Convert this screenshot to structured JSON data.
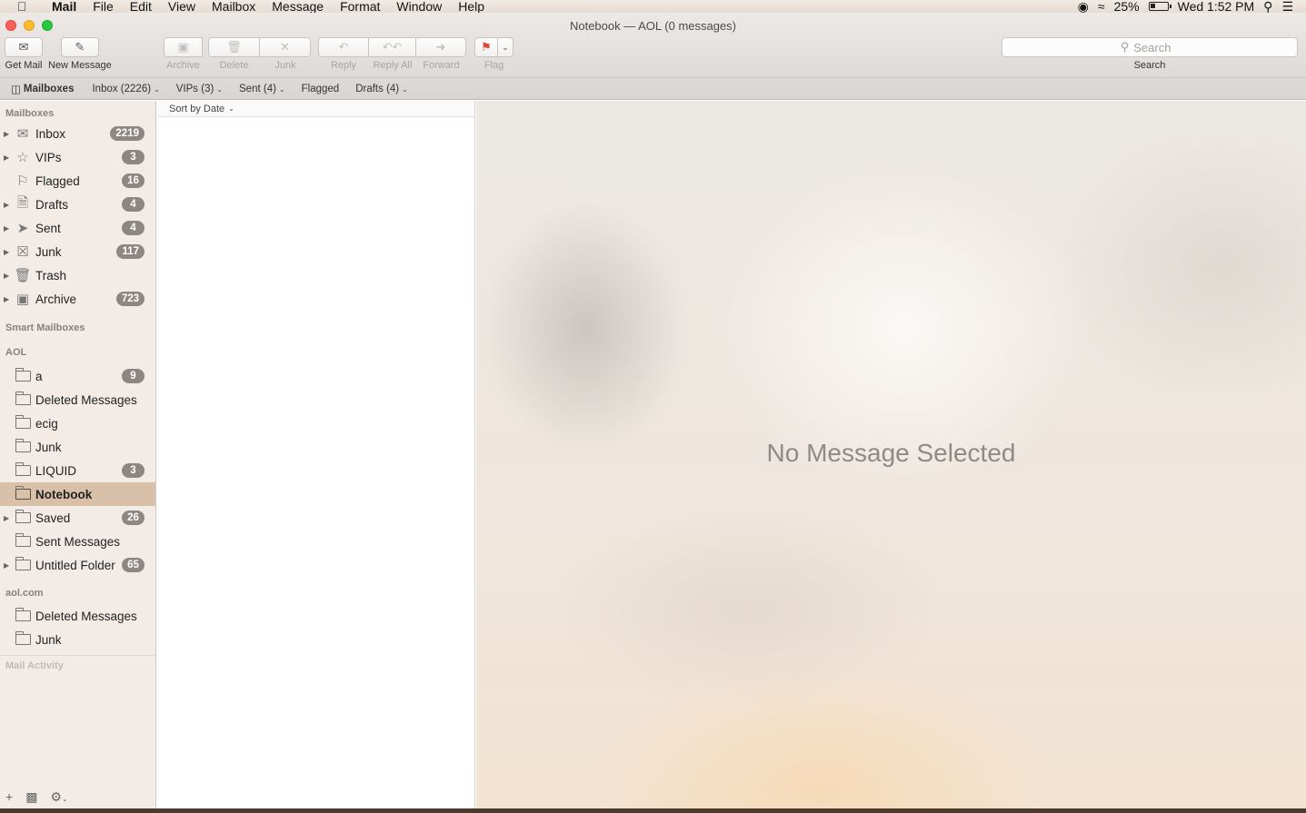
{
  "menubar": {
    "app": "Mail",
    "items": [
      "File",
      "Edit",
      "View",
      "Mailbox",
      "Message",
      "Format",
      "Window",
      "Help"
    ],
    "battery": "25%",
    "clock": "Wed 1:52 PM"
  },
  "window": {
    "title": "Notebook — AOL (0 messages)"
  },
  "toolbar": {
    "get_mail": "Get Mail",
    "new_message": "New Message",
    "archive": "Archive",
    "delete": "Delete",
    "junk": "Junk",
    "reply": "Reply",
    "reply_all": "Reply All",
    "forward": "Forward",
    "flag": "Flag",
    "search_placeholder": "Search",
    "search_label": "Search"
  },
  "favorites": {
    "mailboxes": "Mailboxes",
    "inbox": "Inbox (2226)",
    "vips": "VIPs (3)",
    "sent": "Sent (4)",
    "flagged": "Flagged",
    "drafts": "Drafts (4)"
  },
  "sidebar": {
    "mailboxes_header": "Mailboxes",
    "mailboxes": [
      {
        "label": "Inbox",
        "badge": "2219",
        "icon": "inbox-icon"
      },
      {
        "label": "VIPs",
        "badge": "3",
        "icon": "star-icon"
      },
      {
        "label": "Flagged",
        "badge": "16",
        "icon": "flag-icon"
      },
      {
        "label": "Drafts",
        "badge": "4",
        "icon": "document-icon"
      },
      {
        "label": "Sent",
        "badge": "4",
        "icon": "paper-plane-icon"
      },
      {
        "label": "Junk",
        "badge": "117",
        "icon": "junk-tray-icon"
      },
      {
        "label": "Trash",
        "badge": "",
        "icon": "trash-icon"
      },
      {
        "label": "Archive",
        "badge": "723",
        "icon": "archive-box-icon"
      }
    ],
    "smart_header": "Smart Mailboxes",
    "aol_header": "AOL",
    "aol": [
      {
        "label": "a",
        "badge": "9"
      },
      {
        "label": "Deleted Messages",
        "badge": ""
      },
      {
        "label": "ecig",
        "badge": ""
      },
      {
        "label": "Junk",
        "badge": ""
      },
      {
        "label": "LIQUID",
        "badge": "3"
      },
      {
        "label": "Notebook",
        "badge": ""
      },
      {
        "label": "Saved",
        "badge": "26"
      },
      {
        "label": "Sent Messages",
        "badge": ""
      },
      {
        "label": "Untitled Folder",
        "badge": "65"
      }
    ],
    "aolcom_header": "aol.com",
    "aolcom": [
      {
        "label": "Deleted Messages",
        "badge": ""
      },
      {
        "label": "Junk",
        "badge": ""
      }
    ],
    "activity_header": "Mail Activity"
  },
  "message_list": {
    "sort_label": "Sort by Date"
  },
  "preview": {
    "empty_text": "No Message Selected"
  },
  "colors": {
    "selected_row": "#d9c1a9",
    "badge": "#8e8781",
    "flag_red": "#e0453a"
  }
}
